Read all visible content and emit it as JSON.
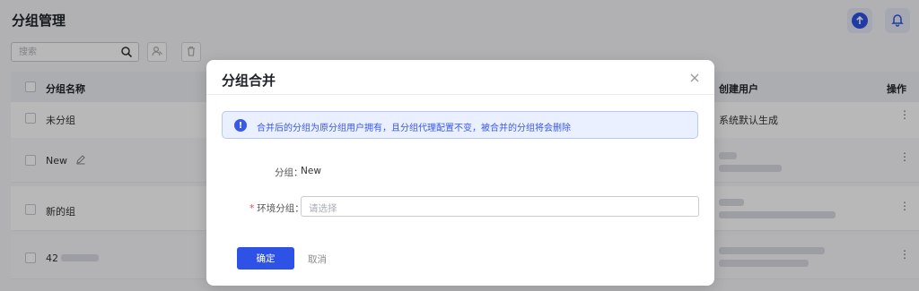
{
  "page": {
    "title": "分组管理",
    "search_placeholder": "搜索"
  },
  "table": {
    "headers": {
      "name": "分组名称",
      "creator": "创建用户",
      "actions": "操作"
    },
    "rows": [
      {
        "name": "未分组",
        "creator": "系统默认生成"
      },
      {
        "name": "New",
        "creator": ""
      },
      {
        "name": "新的组",
        "creator": ""
      },
      {
        "name": "42",
        "creator": ""
      }
    ]
  },
  "modal": {
    "title": "分组合并",
    "notice": "合并后的分组为原分组用户拥有，且分组代理配置不变，被合并的分组将会删除",
    "group_label": "分组：",
    "group_value": "New",
    "target_label": "环境分组：",
    "target_placeholder": "请选择",
    "required_mark": "*",
    "confirm_label": "确定",
    "cancel_label": "取消"
  },
  "colors": {
    "primary": "#2e52e6",
    "notice_bg": "#eaf0ff",
    "required": "#e5484d"
  }
}
